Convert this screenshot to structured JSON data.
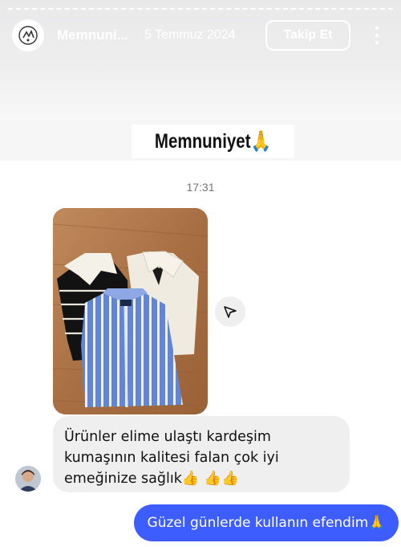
{
  "header": {
    "account_name": "Memnuni...",
    "date": "5 Temmuz 2024",
    "follow_label": "Takip Et"
  },
  "story": {
    "caption": "Memnuniyet🙏"
  },
  "chat": {
    "time": "17:31",
    "received_message": "Ürünler elime ulaştı kardeşim kumaşının kalitesi falan çok iyi emeğinize sağlık👍 👍👍",
    "sent_message": "Güzel günlerde kullanın efendim🙏"
  },
  "colors": {
    "sent_bubble": "#3e5dff",
    "received_bubble": "#efefef"
  }
}
